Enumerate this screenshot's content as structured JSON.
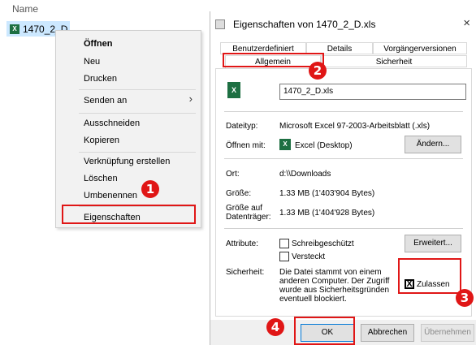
{
  "explorer": {
    "column_header": "Name",
    "file_name": "1470_2_D"
  },
  "context_menu": {
    "items": [
      "Öffnen",
      "Neu",
      "Drucken",
      "Senden an",
      "Ausschneiden",
      "Kopieren",
      "Verknüpfung erstellen",
      "Löschen",
      "Umbenennen",
      "Eigenschaften"
    ]
  },
  "dialog": {
    "title": "Eigenschaften von 1470_2_D.xls",
    "close": "×",
    "tabs_row1": [
      "Benutzerdefiniert",
      "Details",
      "Vorgängerversionen"
    ],
    "tabs_row2": [
      "Allgemein",
      "Sicherheit"
    ],
    "file_name_value": "1470_2_D.xls",
    "labels": {
      "dateityp": "Dateityp:",
      "oeffnen_mit": "Öffnen mit:",
      "ort": "Ort:",
      "groesse": "Größe:",
      "groesse_auf": "Größe auf Datenträger:",
      "attribute": "Attribute:",
      "sicherheit": "Sicherheit:"
    },
    "values": {
      "dateityp": "Microsoft Excel 97-2003-Arbeitsblatt (.xls)",
      "oeffnen_mit": "Excel (Desktop)",
      "ort": "d:\\\\Downloads",
      "groesse": "1.33 MB (1'403'904 Bytes)",
      "groesse_auf": "1.33 MB (1'404'928 Bytes)",
      "sicherheit_text": "Die Datei stammt von einem anderen Computer. Der Zugriff wurde aus Sicherheitsgründen eventuell blockiert."
    },
    "buttons": {
      "aendern": "Ändern...",
      "erweitert": "Erweitert...",
      "ok": "OK",
      "abbrechen": "Abbrechen",
      "uebernehmen": "Übernehmen"
    },
    "checkboxes": {
      "schreibgeschuetzt": "Schreibgeschützt",
      "versteckt": "Versteckt",
      "zulassen": "Zulassen",
      "zulassen_mark": "X"
    }
  },
  "badges": [
    "1",
    "2",
    "3",
    "4"
  ],
  "colors": {
    "highlight_red": "#e01616",
    "excel_green": "#1d6f42",
    "selection_blue": "#cce8ff"
  }
}
